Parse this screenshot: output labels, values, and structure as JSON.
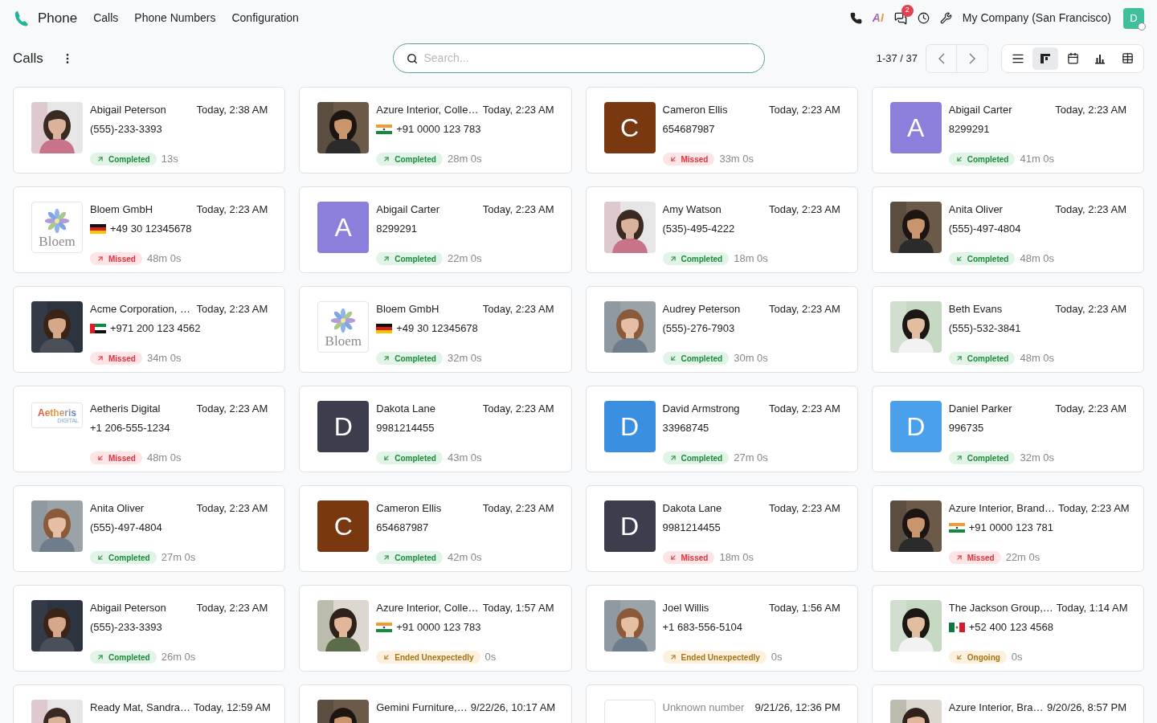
{
  "app": {
    "name": "Phone",
    "menu": [
      "Calls",
      "Phone Numbers",
      "Configuration"
    ]
  },
  "systray": {
    "ai_label": "AI",
    "chat_count": "2",
    "company": "My Company (San Francisco)",
    "user_initial": "D"
  },
  "control": {
    "title": "Calls",
    "search_placeholder": "Search...",
    "pager": "1-37 / 37",
    "views": [
      {
        "kind": "list",
        "selected": false
      },
      {
        "kind": "kanban",
        "selected": true
      },
      {
        "kind": "calendar",
        "selected": false
      },
      {
        "kind": "graph",
        "selected": false
      },
      {
        "kind": "pivot",
        "selected": false
      }
    ]
  },
  "calls": [
    {
      "name": "Abigail Peterson",
      "time": "Today, 2:38 AM",
      "number": "(555)-233-3393",
      "status": {
        "label": "Completed",
        "kind": "completed",
        "incoming": false
      },
      "duration": "13s"
    },
    {
      "name": "Azure Interior, Colle…",
      "time": "Today, 2:23 AM",
      "flag": {
        "kind": "india"
      },
      "number": "+91 0000 123 783",
      "status": {
        "label": "Completed",
        "kind": "completed",
        "incoming": false
      },
      "duration": "28m 0s"
    },
    {
      "name": "Cameron Ellis",
      "time": "Today, 2:23 AM",
      "number": "654687987",
      "status": {
        "label": "Missed",
        "kind": "missed",
        "incoming": true
      },
      "duration": "33m 0s",
      "avatar": {
        "kind": "letter",
        "letter": "C",
        "color": "#7a3810"
      }
    },
    {
      "name": "Abigail Carter",
      "time": "Today, 2:23 AM",
      "number": "8299291",
      "status": {
        "label": "Completed",
        "kind": "completed",
        "incoming": true
      },
      "duration": "41m 0s",
      "avatar": {
        "kind": "letter",
        "letter": "A",
        "color": "#8a80dc"
      }
    },
    {
      "name": "Bloem GmbH",
      "time": "Today, 2:23 AM",
      "flag": {
        "kind": "germany"
      },
      "number": "+49 30 12345678",
      "status": {
        "label": "Missed",
        "kind": "missed",
        "incoming": false
      },
      "duration": "48m 0s",
      "avatar": {
        "kind": "flower-logo",
        "text": "Bloem"
      }
    },
    {
      "name": "Abigail Carter",
      "time": "Today, 2:23 AM",
      "number": "8299291",
      "status": {
        "label": "Completed",
        "kind": "completed",
        "incoming": false
      },
      "duration": "22m 0s",
      "avatar": {
        "kind": "letter",
        "letter": "A",
        "color": "#8a80dc"
      }
    },
    {
      "name": "Amy Watson",
      "time": "Today, 2:23 AM",
      "number": "(535)-495-4222",
      "status": {
        "label": "Completed",
        "kind": "completed",
        "incoming": false
      },
      "duration": "18m 0s"
    },
    {
      "name": "Anita Oliver",
      "time": "Today, 2:23 AM",
      "number": "(555)-497-4804",
      "status": {
        "label": "Completed",
        "kind": "completed",
        "incoming": true
      },
      "duration": "48m 0s"
    },
    {
      "name": "Acme Corporation, …",
      "time": "Today, 2:23 AM",
      "flag": {
        "kind": "uae"
      },
      "number": "+971 200 123 4562",
      "status": {
        "label": "Missed",
        "kind": "missed",
        "incoming": false
      },
      "duration": "34m 0s"
    },
    {
      "name": "Bloem GmbH",
      "time": "Today, 2:23 AM",
      "flag": {
        "kind": "germany"
      },
      "number": "+49 30 12345678",
      "status": {
        "label": "Completed",
        "kind": "completed",
        "incoming": false
      },
      "duration": "32m 0s",
      "avatar": {
        "kind": "flower-logo",
        "text": "Bloem"
      }
    },
    {
      "name": "Audrey Peterson",
      "time": "Today, 2:23 AM",
      "number": "(555)-276-7903",
      "status": {
        "label": "Completed",
        "kind": "completed",
        "incoming": true
      },
      "duration": "30m 0s"
    },
    {
      "name": "Beth Evans",
      "time": "Today, 2:23 AM",
      "number": "(555)-532-3841",
      "status": {
        "label": "Completed",
        "kind": "completed",
        "incoming": false
      },
      "duration": "48m 0s"
    },
    {
      "name": "Aetheris Digital",
      "time": "Today, 2:23 AM",
      "number": "+1 206-555-1234",
      "status": {
        "label": "Missed",
        "kind": "missed",
        "incoming": true
      },
      "duration": "48m 0s",
      "avatar": {
        "kind": "word-logo",
        "text": "Aetheris",
        "subtext": "DIGITAL"
      }
    },
    {
      "name": "Dakota Lane",
      "time": "Today, 2:23 AM",
      "number": "9981214455",
      "status": {
        "label": "Completed",
        "kind": "completed",
        "incoming": true
      },
      "duration": "43m 0s",
      "avatar": {
        "kind": "letter",
        "letter": "D",
        "color": "#3d3e4d"
      }
    },
    {
      "name": "David Armstrong",
      "time": "Today, 2:23 AM",
      "number": "33968745",
      "status": {
        "label": "Completed",
        "kind": "completed",
        "incoming": false
      },
      "duration": "27m 0s",
      "avatar": {
        "kind": "letter",
        "letter": "D",
        "color": "#3a8fe0"
      }
    },
    {
      "name": "Daniel Parker",
      "time": "Today, 2:23 AM",
      "number": "996735",
      "status": {
        "label": "Completed",
        "kind": "completed",
        "incoming": false
      },
      "duration": "32m 0s",
      "avatar": {
        "kind": "letter",
        "letter": "D",
        "color": "#4aa0ea"
      }
    },
    {
      "name": "Anita Oliver",
      "time": "Today, 2:23 AM",
      "number": "(555)-497-4804",
      "status": {
        "label": "Completed",
        "kind": "completed",
        "incoming": true
      },
      "duration": "27m 0s"
    },
    {
      "name": "Cameron Ellis",
      "time": "Today, 2:23 AM",
      "number": "654687987",
      "status": {
        "label": "Completed",
        "kind": "completed",
        "incoming": false
      },
      "duration": "42m 0s",
      "avatar": {
        "kind": "letter",
        "letter": "C",
        "color": "#7a3810"
      }
    },
    {
      "name": "Dakota Lane",
      "time": "Today, 2:23 AM",
      "number": "9981214455",
      "status": {
        "label": "Missed",
        "kind": "missed",
        "incoming": true
      },
      "duration": "18m 0s",
      "avatar": {
        "kind": "letter",
        "letter": "D",
        "color": "#3d3e4d"
      }
    },
    {
      "name": "Azure Interior, Brand…",
      "time": "Today, 2:23 AM",
      "flag": {
        "kind": "india"
      },
      "number": "+91 0000 123 781",
      "status": {
        "label": "Missed",
        "kind": "missed",
        "incoming": false
      },
      "duration": "22m 0s"
    },
    {
      "name": "Abigail Peterson",
      "time": "Today, 2:23 AM",
      "number": "(555)-233-3393",
      "status": {
        "label": "Completed",
        "kind": "completed",
        "incoming": false
      },
      "duration": "26m 0s"
    },
    {
      "name": "Azure Interior, Colle…",
      "time": "Today, 1:57 AM",
      "flag": {
        "kind": "india"
      },
      "number": "+91 0000 123 783",
      "status": {
        "label": "Ended Unexpectedly",
        "kind": "ended",
        "incoming": true
      },
      "duration": "0s"
    },
    {
      "name": "Joel Willis",
      "time": "Today, 1:56 AM",
      "number": "+1 683-556-5104",
      "status": {
        "label": "Ended Unexpectedly",
        "kind": "ended",
        "incoming": false
      },
      "duration": "0s"
    },
    {
      "name": "The Jackson Group,…",
      "time": "Today, 1:14 AM",
      "flag": {
        "kind": "mexico"
      },
      "number": "+52 400 123 4568",
      "status": {
        "label": "Ongoing",
        "kind": "ongoing",
        "incoming": true
      },
      "duration": "0s"
    },
    {
      "name": "Ready Mat, Sandra…",
      "time": "Today, 12:59 AM"
    },
    {
      "name": "Gemini Furniture,…",
      "time": "9/22/26, 10:17 AM"
    },
    {
      "name": "Unknown number",
      "time": "9/21/26, 12:36 PM",
      "avatar": {
        "kind": "placeholder"
      }
    },
    {
      "name": "Azure Interior, Bra…",
      "time": "9/20/26, 8:57 PM"
    }
  ]
}
